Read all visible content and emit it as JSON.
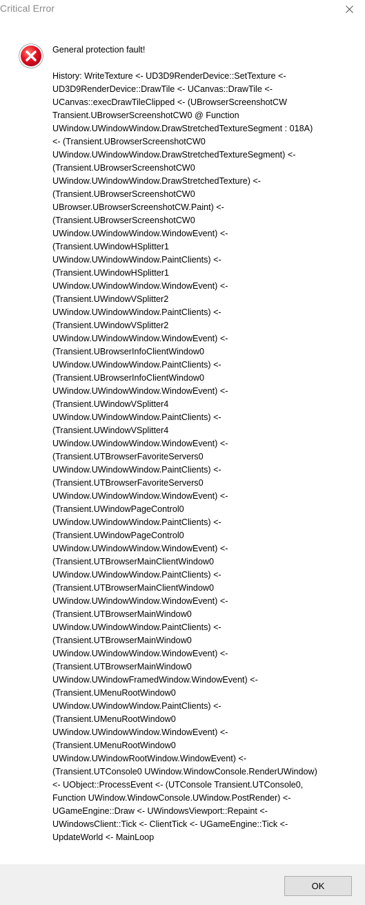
{
  "window": {
    "title": "Critical Error",
    "close_icon": "close-icon"
  },
  "dialog": {
    "icon": "error-icon",
    "icon_color": "#e81123",
    "headline": "General protection fault!",
    "history": "History: WriteTexture <- UD3D9RenderDevice::SetTexture <-\nUD3D9RenderDevice::DrawTile <- UCanvas::DrawTile <-\nUCanvas::execDrawTileClipped <- (UBrowserScreenshotCW\nTransient.UBrowserScreenshotCW0 @ Function\nUWindow.UWindowWindow.DrawStretchedTextureSegment : 018A)\n<- (Transient.UBrowserScreenshotCW0\nUWindow.UWindowWindow.DrawStretchedTextureSegment) <-\n(Transient.UBrowserScreenshotCW0\nUWindow.UWindowWindow.DrawStretchedTexture) <-\n(Transient.UBrowserScreenshotCW0\nUBrowser.UBrowserScreenshotCW.Paint) <-\n(Transient.UBrowserScreenshotCW0\nUWindow.UWindowWindow.WindowEvent) <-\n(Transient.UWindowHSplitter1\nUWindow.UWindowWindow.PaintClients) <-\n(Transient.UWindowHSplitter1\nUWindow.UWindowWindow.WindowEvent) <-\n(Transient.UWindowVSplitter2\nUWindow.UWindowWindow.PaintClients) <-\n(Transient.UWindowVSplitter2\nUWindow.UWindowWindow.WindowEvent) <-\n(Transient.UBrowserInfoClientWindow0\nUWindow.UWindowWindow.PaintClients) <-\n(Transient.UBrowserInfoClientWindow0\nUWindow.UWindowWindow.WindowEvent) <-\n(Transient.UWindowVSplitter4\nUWindow.UWindowWindow.PaintClients) <-\n(Transient.UWindowVSplitter4\nUWindow.UWindowWindow.WindowEvent) <-\n(Transient.UTBrowserFavoriteServers0\nUWindow.UWindowWindow.PaintClients) <-\n(Transient.UTBrowserFavoriteServers0\nUWindow.UWindowWindow.WindowEvent) <-\n(Transient.UWindowPageControl0\nUWindow.UWindowWindow.PaintClients) <-\n(Transient.UWindowPageControl0\nUWindow.UWindowWindow.WindowEvent) <-\n(Transient.UTBrowserMainClientWindow0\nUWindow.UWindowWindow.PaintClients) <-\n(Transient.UTBrowserMainClientWindow0\nUWindow.UWindowWindow.WindowEvent) <-\n(Transient.UTBrowserMainWindow0\nUWindow.UWindowWindow.PaintClients) <-\n(Transient.UTBrowserMainWindow0\nUWindow.UWindowWindow.WindowEvent) <-\n(Transient.UTBrowserMainWindow0\nUWindow.UWindowFramedWindow.WindowEvent) <-\n(Transient.UMenuRootWindow0\nUWindow.UWindowWindow.PaintClients) <-\n(Transient.UMenuRootWindow0\nUWindow.UWindowWindow.WindowEvent) <-\n(Transient.UMenuRootWindow0\nUWindow.UWindowRootWindow.WindowEvent) <-\n(Transient.UTConsole0 UWindow.WindowConsole.RenderUWindow)\n<- UObject::ProcessEvent <- (UTConsole Transient.UTConsole0,\nFunction UWindow.WindowConsole.UWindow.PostRender) <-\nUGameEngine::Draw <- UWindowsViewport::Repaint <-\nUWindowsClient::Tick <- ClientTick <- UGameEngine::Tick <-\nUpdateWorld <- MainLoop"
  },
  "footer": {
    "ok_label": "OK"
  }
}
